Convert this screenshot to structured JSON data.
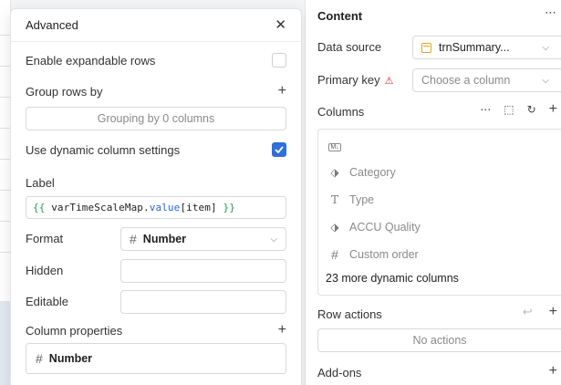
{
  "modal": {
    "title": "Advanced",
    "enable_expandable_rows": {
      "label": "Enable expandable rows",
      "checked": false
    },
    "group_rows_by": {
      "label": "Group rows by",
      "value": "Grouping by 0 columns"
    },
    "use_dynamic_column_settings": {
      "label": "Use dynamic column settings",
      "checked": true
    },
    "label_field": {
      "label": "Label",
      "open": "{{",
      "ident": "varTimeScaleMap",
      "dot": ".",
      "prop": "value",
      "index": "[item]",
      "close": "}}"
    },
    "format": {
      "label": "Format",
      "value": "Number"
    },
    "hidden": {
      "label": "Hidden",
      "value": ""
    },
    "editable": {
      "label": "Editable",
      "value": ""
    },
    "column_properties": {
      "label": "Column properties",
      "items": [
        "Number"
      ]
    }
  },
  "panel": {
    "title": "Content",
    "data_source": {
      "label": "Data source",
      "value": "trnSummary..."
    },
    "primary_key": {
      "label": "Primary key",
      "placeholder": "Choose a column"
    },
    "columns": {
      "label": "Columns",
      "items": [
        {
          "icon": "markdown-icon",
          "name": ""
        },
        {
          "icon": "tag-icon",
          "name": "Category"
        },
        {
          "icon": "text-type-icon",
          "name": "Type"
        },
        {
          "icon": "tag-icon",
          "name": "ACCU Quality"
        },
        {
          "icon": "hash-icon",
          "name": "Custom order"
        }
      ],
      "more": "23 more dynamic columns"
    },
    "row_actions": {
      "label": "Row actions",
      "empty": "No actions"
    },
    "add_ons": {
      "label": "Add-ons"
    }
  },
  "colors": {
    "accent": "#2f6fdc",
    "warning": "#dc2626",
    "datasource_icon": "#e8a317",
    "code_brace": "#16a34a",
    "code_prop": "#2563eb"
  }
}
